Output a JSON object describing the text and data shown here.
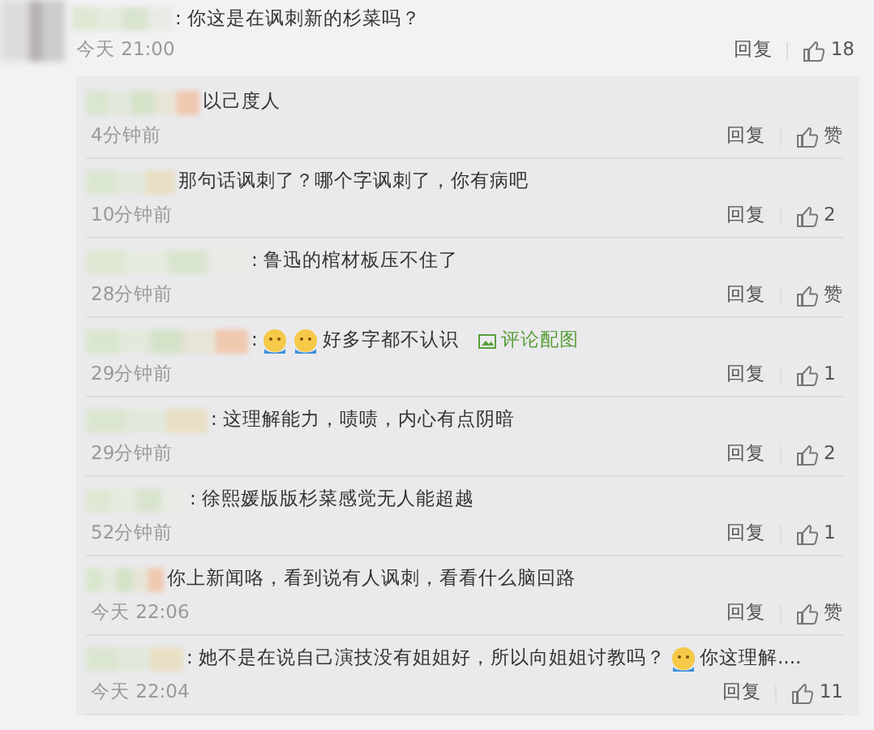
{
  "comment": {
    "text": ": 你这是在讽刺新的杉菜吗？",
    "time": "今天 21:00",
    "reply": "回复",
    "likes": "18"
  },
  "replies": [
    {
      "segments": [
        {
          "kind": "text",
          "text": "以己度人"
        }
      ],
      "time": "4分钟前",
      "reply": "回复",
      "likes": "赞"
    },
    {
      "segments": [
        {
          "kind": "text",
          "text": "那句话讽刺了？哪个字讽刺了，你有病吧"
        }
      ],
      "time": "10分钟前",
      "reply": "回复",
      "likes": "2"
    },
    {
      "segments": [
        {
          "kind": "text",
          "text": ": 鲁迅的棺材板压不住了"
        }
      ],
      "time": "28分钟前",
      "reply": "回复",
      "likes": "赞"
    },
    {
      "segments": [
        {
          "kind": "text",
          "text": ": "
        },
        {
          "kind": "emoji"
        },
        {
          "kind": "emoji"
        },
        {
          "kind": "text",
          "text": "好多字都不认识"
        },
        {
          "kind": "link",
          "text": "评论配图"
        }
      ],
      "time": "29分钟前",
      "reply": "回复",
      "likes": "1"
    },
    {
      "segments": [
        {
          "kind": "text",
          "text": ": 这理解能力，啧啧，内心有点阴暗"
        }
      ],
      "time": "29分钟前",
      "reply": "回复",
      "likes": "2"
    },
    {
      "segments": [
        {
          "kind": "text",
          "text": ": 徐熙媛版版杉菜感觉无人能超越"
        }
      ],
      "time": "52分钟前",
      "reply": "回复",
      "likes": "1"
    },
    {
      "segments": [
        {
          "kind": "text",
          "text": "你上新闻咯，看到说有人讽刺，看看什么脑回路"
        }
      ],
      "time": "今天 22:06",
      "reply": "回复",
      "likes": "赞"
    },
    {
      "segments": [
        {
          "kind": "text",
          "text": ": 她不是在说自己演技没有姐姐好，所以向姐姐讨教吗？"
        },
        {
          "kind": "emoji"
        },
        {
          "kind": "text",
          "text": "你这理解...."
        }
      ],
      "time": "今天 22:04",
      "reply": "回复",
      "likes": "11"
    }
  ]
}
